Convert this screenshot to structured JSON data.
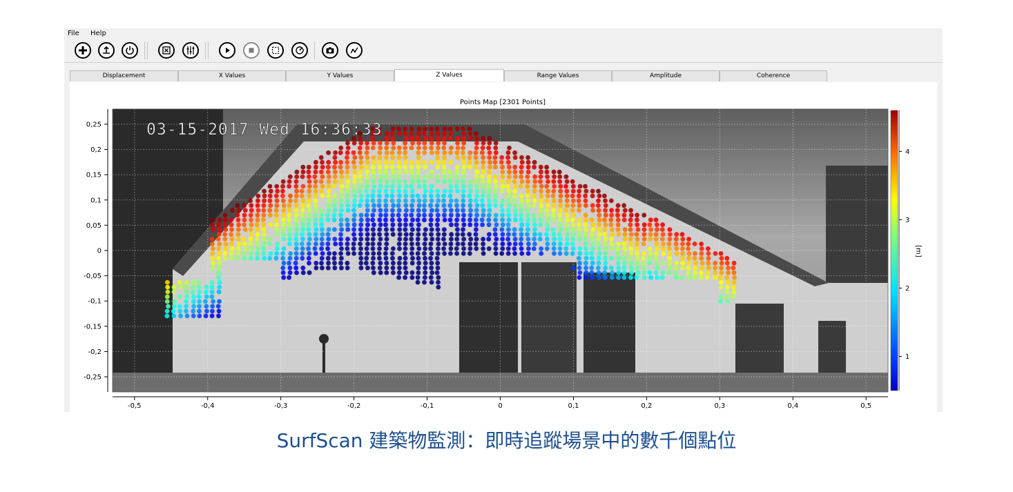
{
  "menu": {
    "file": "File",
    "help": "Help"
  },
  "toolbar": {
    "buttons": [
      {
        "name": "add-icon"
      },
      {
        "name": "upload-icon"
      },
      {
        "name": "power-icon"
      },
      {
        "name": "fit-view-icon"
      },
      {
        "name": "sliders-icon"
      },
      {
        "name": "play-icon"
      },
      {
        "name": "stop-icon"
      },
      {
        "name": "select-area-icon"
      },
      {
        "name": "timer-icon"
      },
      {
        "name": "camera-icon"
      },
      {
        "name": "trend-icon"
      }
    ]
  },
  "tabs": [
    {
      "label": "Displacement"
    },
    {
      "label": "X Values"
    },
    {
      "label": "Y Values"
    },
    {
      "label": "Z Values",
      "active": true
    },
    {
      "label": "Range Values"
    },
    {
      "label": "Amplitude"
    },
    {
      "label": "Coherence"
    }
  ],
  "overlay": {
    "timestamp": "03-15-2017 Wed 16:36:33"
  },
  "chart_data": {
    "type": "scatter",
    "title": "Points Map [2301 Points]",
    "x_ticks": [
      "-0,5",
      "-0,4",
      "-0,3",
      "-0,2",
      "-0,1",
      "0",
      "0,1",
      "0,2",
      "0,3",
      "0,4",
      "0,5"
    ],
    "y_ticks": [
      "0,25",
      "0,2",
      "0,15",
      "0,1",
      "0,05",
      "0",
      "-0,05",
      "-0,1",
      "-0,15",
      "-0,2",
      "-0,25"
    ],
    "xlim": [
      -0.53,
      0.53
    ],
    "ylim": [
      -0.28,
      0.28
    ],
    "point_count": 2301,
    "colorbar": {
      "label": "[m]",
      "ticks": [
        "4",
        "3",
        "2",
        "1"
      ],
      "range": [
        0.5,
        4.6
      ],
      "colormap": "jet"
    },
    "grid": true
  },
  "caption": "SurfScan 建築物監測：即時追蹤場景中的數千個點位"
}
